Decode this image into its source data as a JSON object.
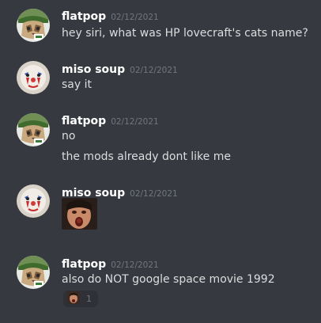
{
  "messages": [
    {
      "author": "flatpop",
      "timestamp": "02/12/2021",
      "lines": [
        "hey siri, what was HP lovecraft's cats name?"
      ]
    },
    {
      "author": "miso soup",
      "timestamp": "02/12/2021",
      "lines": [
        "say it"
      ]
    },
    {
      "author": "flatpop",
      "timestamp": "02/12/2021",
      "lines": [
        "no",
        "the mods already dont like me"
      ]
    },
    {
      "author": "miso soup",
      "timestamp": "02/12/2021",
      "emoji": "screaming-face-emoji"
    },
    {
      "author": "flatpop",
      "timestamp": "02/12/2021",
      "lines": [
        "also do NOT google space movie 1992"
      ],
      "reaction": {
        "emoji": "face-emoji",
        "count": "1"
      }
    }
  ],
  "colors": {
    "background": "#36393f",
    "username": "#ffffff",
    "text": "#dcddde",
    "timestamp": "#72767d",
    "reaction_bg": "#2f3136"
  }
}
